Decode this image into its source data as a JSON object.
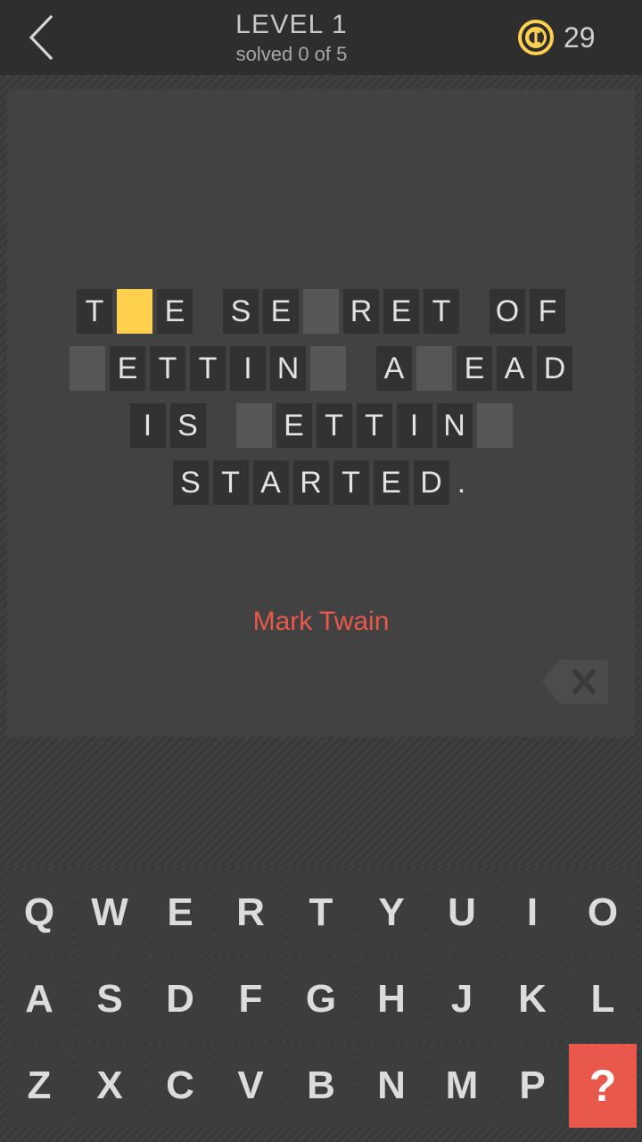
{
  "header": {
    "back_icon": "chevron-left-icon",
    "title": "LEVEL 1",
    "subtitle": "solved 0 of 5",
    "coin_icon": "coin-icon",
    "coin_count": "29",
    "coin_color": "#fdd04e"
  },
  "puzzle": {
    "quote_text": "THE SECRET OF GETTING AHEAD IS GETTING STARTED.",
    "author": "Mark Twain",
    "author_color": "#e8584b",
    "active_tile_color": "#fdd04e",
    "blank_tile_color": "#565656",
    "letter_tile_color": "#323232",
    "rows": [
      {
        "words": [
          {
            "tiles": [
              {
                "char": "T",
                "state": "letter"
              },
              {
                "char": "",
                "state": "active"
              },
              {
                "char": "E",
                "state": "letter"
              }
            ]
          },
          {
            "tiles": [
              {
                "char": "S",
                "state": "letter"
              },
              {
                "char": "E",
                "state": "letter"
              },
              {
                "char": "",
                "state": "blank"
              },
              {
                "char": "R",
                "state": "letter"
              },
              {
                "char": "E",
                "state": "letter"
              },
              {
                "char": "T",
                "state": "letter"
              }
            ]
          },
          {
            "tiles": [
              {
                "char": "O",
                "state": "letter"
              },
              {
                "char": "F",
                "state": "letter"
              }
            ]
          }
        ]
      },
      {
        "words": [
          {
            "tiles": [
              {
                "char": "",
                "state": "blank"
              },
              {
                "char": "E",
                "state": "letter"
              },
              {
                "char": "T",
                "state": "letter"
              },
              {
                "char": "T",
                "state": "letter"
              },
              {
                "char": "I",
                "state": "letter"
              },
              {
                "char": "N",
                "state": "letter"
              },
              {
                "char": "",
                "state": "blank"
              }
            ]
          },
          {
            "tiles": [
              {
                "char": "A",
                "state": "letter"
              },
              {
                "char": "",
                "state": "blank"
              },
              {
                "char": "E",
                "state": "letter"
              },
              {
                "char": "A",
                "state": "letter"
              },
              {
                "char": "D",
                "state": "letter"
              }
            ]
          }
        ]
      },
      {
        "words": [
          {
            "tiles": [
              {
                "char": "I",
                "state": "letter"
              },
              {
                "char": "S",
                "state": "letter"
              }
            ]
          },
          {
            "tiles": [
              {
                "char": "",
                "state": "blank"
              },
              {
                "char": "E",
                "state": "letter"
              },
              {
                "char": "T",
                "state": "letter"
              },
              {
                "char": "T",
                "state": "letter"
              },
              {
                "char": "I",
                "state": "letter"
              },
              {
                "char": "N",
                "state": "letter"
              },
              {
                "char": "",
                "state": "blank"
              }
            ]
          }
        ]
      },
      {
        "words": [
          {
            "tiles": [
              {
                "char": "S",
                "state": "letter"
              },
              {
                "char": "T",
                "state": "letter"
              },
              {
                "char": "A",
                "state": "letter"
              },
              {
                "char": "R",
                "state": "letter"
              },
              {
                "char": "T",
                "state": "letter"
              },
              {
                "char": "E",
                "state": "letter"
              },
              {
                "char": "D",
                "state": "letter"
              },
              {
                "char": ".",
                "state": "punct"
              }
            ]
          }
        ]
      }
    ],
    "backspace_icon": "backspace-delete-icon"
  },
  "keyboard": {
    "rows": [
      [
        "Q",
        "W",
        "E",
        "R",
        "T",
        "Y",
        "U",
        "I",
        "O"
      ],
      [
        "A",
        "S",
        "D",
        "F",
        "G",
        "H",
        "J",
        "K",
        "L"
      ],
      [
        "Z",
        "X",
        "C",
        "V",
        "B",
        "N",
        "M",
        "P",
        "?"
      ]
    ],
    "hint_key_label": "?",
    "hint_key_color": "#e8584b"
  }
}
